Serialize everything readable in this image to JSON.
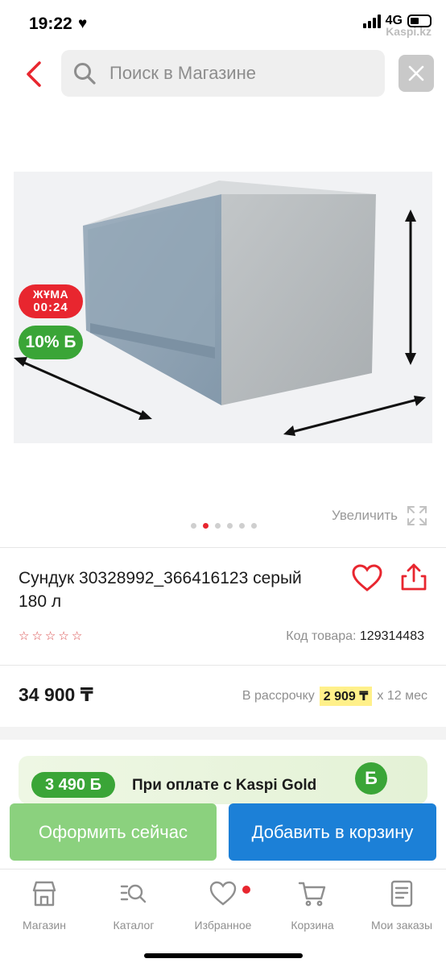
{
  "status_bar": {
    "time": "19:22",
    "network": "4G",
    "watermark": "Kaspi.kz"
  },
  "header": {
    "search_placeholder": "Поиск в Магазине"
  },
  "gallery": {
    "promo_title": "ЖҰМА",
    "promo_timer": "00:24",
    "bonus_label": "10% Б",
    "zoom_label": "Увеличить",
    "dots_count": 6,
    "active_dot": 2
  },
  "product": {
    "title": "Сундук 30328992_366416123 серый 180 л",
    "rating_stars": 5,
    "code_label": "Код товара:",
    "code_value": "129314483",
    "price": "34 900 ₸",
    "installment_prefix": "В рассрочку",
    "installment_amount": "2 909 ₸",
    "installment_suffix": "x 12 мес"
  },
  "gold_banner": {
    "amount": "3 490 Б",
    "text": "При оплате с Kaspi Gold",
    "coin": "Б"
  },
  "actions": {
    "checkout_label": "Оформить сейчас",
    "cart_label": "Добавить в корзину"
  },
  "tabbar": {
    "items": [
      {
        "label": "Магазин",
        "icon": "store-icon"
      },
      {
        "label": "Каталог",
        "icon": "catalog-search-icon"
      },
      {
        "label": "Избранное",
        "icon": "heart-icon"
      },
      {
        "label": "Корзина",
        "icon": "cart-icon"
      },
      {
        "label": "Мои заказы",
        "icon": "orders-icon"
      }
    ]
  },
  "colors": {
    "accent_red": "#e8262f",
    "green": "#3aa537",
    "checkout_green": "#8bd17e",
    "cart_blue": "#1c80d7"
  }
}
